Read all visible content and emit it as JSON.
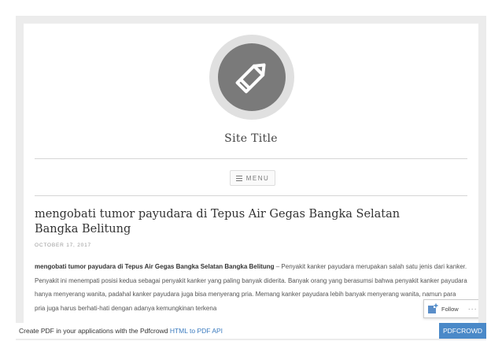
{
  "site": {
    "title": "Site Title",
    "logo_icon": "pencil-icon"
  },
  "nav": {
    "menu_label": "MENU"
  },
  "post": {
    "title": "mengobati tumor payudara di Tepus Air Gegas Bangka Selatan Bangka Belitung",
    "date": "OCTOBER 17, 2017",
    "lead_bold": "mengobati tumor payudara di Tepus Air Gegas Bangka Selatan Bangka Belitung",
    "body": " – Penyakit kanker payudara merupakan salah satu jenis dari kanker. Penyakit ini menempati posisi kedua sebagai penyakit kanker yang paling banyak diderita. Banyak orang yang berasumsi bahwa penyakit kanker payudara hanya menyerang wanita, padahal kanker payudara juga bisa menyerang pria. Memang kanker payudara lebih banyak menyerang wanita, namun para pria juga harus berhati-hati dengan adanya kemungkinan terkena"
  },
  "follow": {
    "label": "Follow",
    "more": "···"
  },
  "pdf_footer": {
    "text": "Create PDF in your applications with the Pdfcrowd ",
    "link": "HTML to PDF API",
    "brand": "PDFCROWD"
  },
  "colors": {
    "logo_dark": "#7a7a7a",
    "logo_ring": "#e0e0e0",
    "frame": "#ececec",
    "pdf_brand": "#4a89c8",
    "link": "#3b7bbf"
  }
}
